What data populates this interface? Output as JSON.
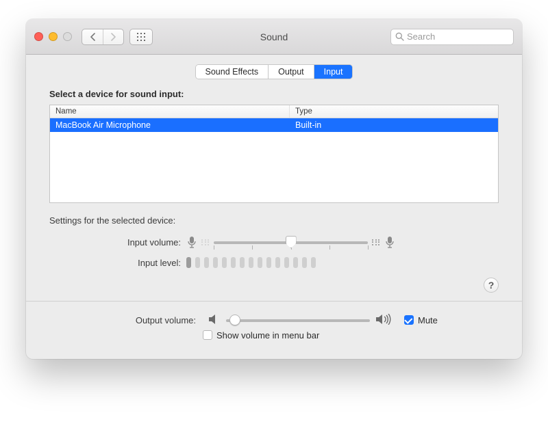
{
  "window_title": "Sound",
  "search_placeholder": "Search",
  "tabs": [
    "Sound Effects",
    "Output",
    "Input"
  ],
  "selected_tab": "Input",
  "section_heading": "Select a device for sound input:",
  "columns": {
    "name": "Name",
    "type": "Type"
  },
  "devices": [
    {
      "name": "MacBook Air Microphone",
      "type": "Built-in",
      "selected": true
    }
  ],
  "settings_heading": "Settings for the selected device:",
  "labels": {
    "input_volume": "Input volume:",
    "input_level": "Input level:",
    "output_volume": "Output volume:",
    "mute": "Mute",
    "show_in_menubar": "Show volume in menu bar"
  },
  "input_volume_percent": 50,
  "input_level_bars_total": 15,
  "input_level_bars_active": 1,
  "output_volume_percent": 6,
  "mute_checked": true,
  "show_in_menubar_checked": false,
  "colors": {
    "accent": "#1a73ff"
  }
}
